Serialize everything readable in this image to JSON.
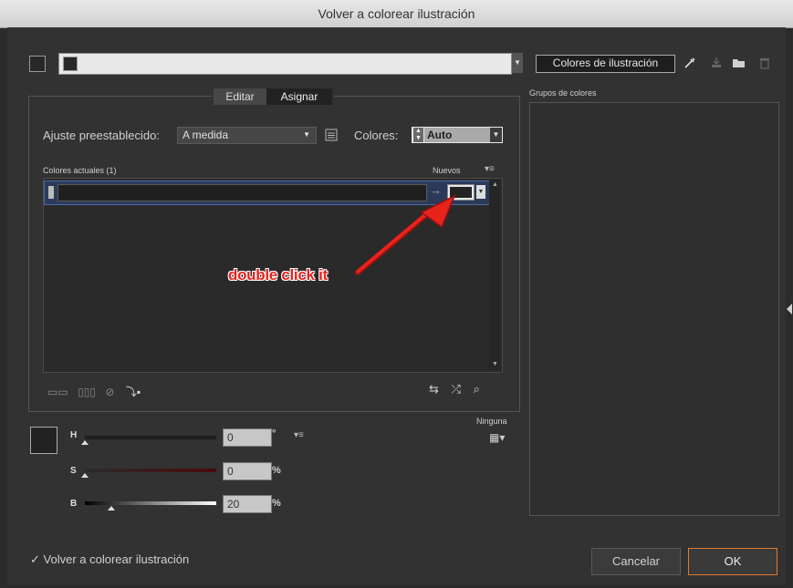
{
  "window": {
    "title": "Volver a colorear ilustración"
  },
  "top": {
    "artwork_colors_button": "Colores de ilustración"
  },
  "tabs": [
    {
      "label": "Editar"
    },
    {
      "label": "Asignar"
    }
  ],
  "preset": {
    "label": "Ajuste preestablecido:",
    "value": "A medida"
  },
  "colors": {
    "label": "Colores:",
    "value": "Auto"
  },
  "current_colors": {
    "header": "Colores actuales (1)",
    "new_header": "Nuevos"
  },
  "color_groups": {
    "header": "Grupos de colores"
  },
  "annotation": {
    "text": "double click it",
    "color": "#e8231c"
  },
  "hsb": {
    "h": {
      "label": "H",
      "value": "0",
      "unit": "°",
      "level": 0
    },
    "s": {
      "label": "S",
      "value": "0",
      "unit": "%",
      "level": 0
    },
    "b": {
      "label": "B",
      "value": "20",
      "unit": "%",
      "level": 0.2
    }
  },
  "none_label": "Ninguna",
  "recolor_checkbox": {
    "checked": true,
    "mark": "✓",
    "label": "Volver a colorear ilustración"
  },
  "buttons": {
    "cancel": "Cancelar",
    "ok": "OK"
  },
  "accent_color": "#e07a2e"
}
